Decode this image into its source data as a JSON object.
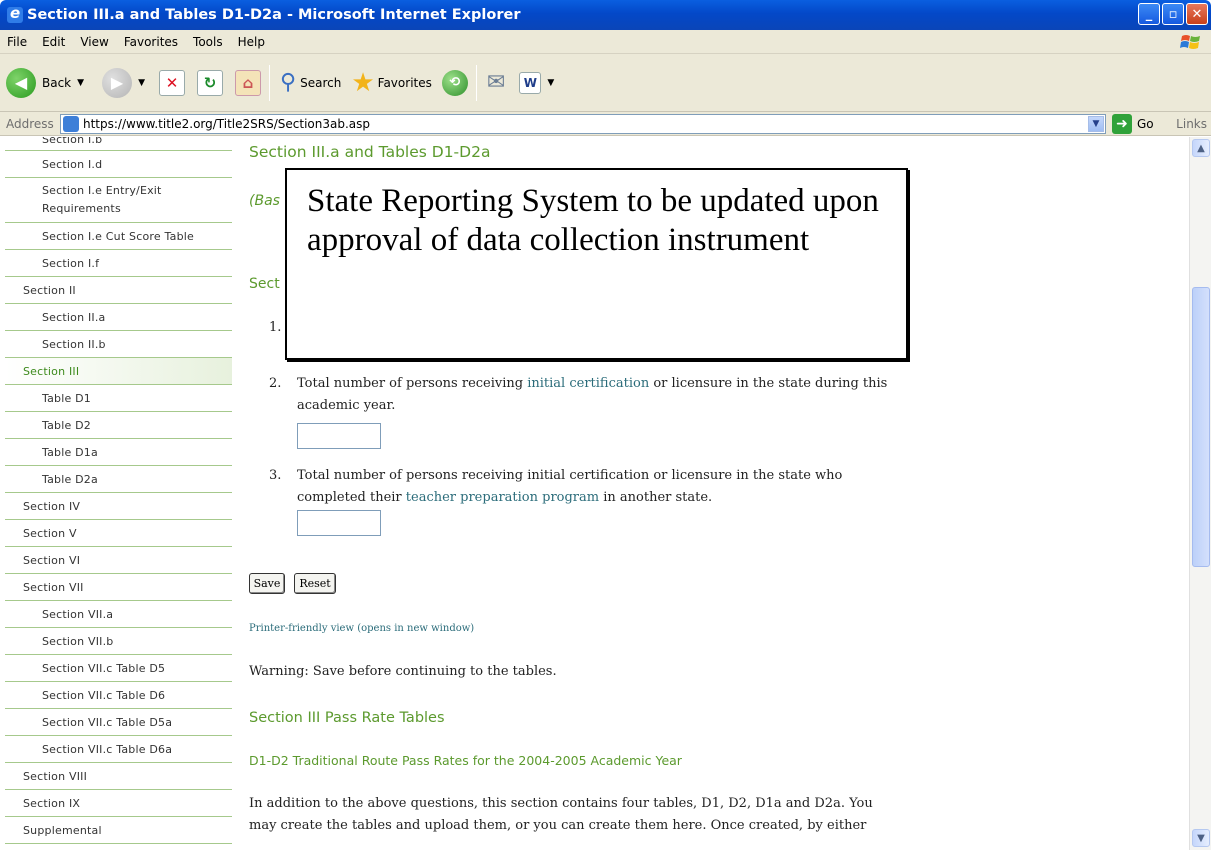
{
  "window": {
    "title": "Section III.a and Tables D1-D2a - Microsoft Internet Explorer",
    "buttons": [
      "_",
      "▫",
      "✕"
    ]
  },
  "menu": [
    "File",
    "Edit",
    "View",
    "Favorites",
    "Tools",
    "Help"
  ],
  "toolbar": {
    "back_label": "Back",
    "search_label": "Search",
    "favorites_label": "Favorites"
  },
  "address": {
    "label": "Address",
    "url": "https://www.title2.org/Title2SRS/Section3ab.asp",
    "go_label": "Go",
    "links_label": "Links"
  },
  "sidebar": {
    "items": [
      {
        "label": "Section I.b",
        "level": "sub"
      },
      {
        "label": "Section I.d",
        "level": "sub"
      },
      {
        "label": "Section I.e Entry/Exit Requirements",
        "level": "sub"
      },
      {
        "label": "Section I.e Cut Score Table",
        "level": "sub"
      },
      {
        "label": "Section I.f",
        "level": "sub"
      },
      {
        "label": "Section II",
        "level": "top"
      },
      {
        "label": "Section II.a",
        "level": "sub"
      },
      {
        "label": "Section II.b",
        "level": "sub"
      },
      {
        "label": "Section III",
        "level": "top",
        "active": true
      },
      {
        "label": "Table D1",
        "level": "sub"
      },
      {
        "label": "Table D2",
        "level": "sub"
      },
      {
        "label": "Table D1a",
        "level": "sub"
      },
      {
        "label": "Table D2a",
        "level": "sub"
      },
      {
        "label": "Section IV",
        "level": "top"
      },
      {
        "label": "Section V",
        "level": "top"
      },
      {
        "label": "Section VI",
        "level": "top"
      },
      {
        "label": "Section VII",
        "level": "top"
      },
      {
        "label": "Section VII.a",
        "level": "sub"
      },
      {
        "label": "Section VII.b",
        "level": "sub"
      },
      {
        "label": "Section VII.c Table D5",
        "level": "sub"
      },
      {
        "label": "Section VII.c Table D6",
        "level": "sub"
      },
      {
        "label": "Section VII.c Table D5a",
        "level": "sub"
      },
      {
        "label": "Section VII.c Table D6a",
        "level": "sub"
      },
      {
        "label": "Section VIII",
        "level": "top"
      },
      {
        "label": "Section IX",
        "level": "top"
      },
      {
        "label": "Supplemental",
        "level": "top"
      }
    ]
  },
  "main": {
    "heading": "Section III.a and Tables D1-D2a",
    "basis_fragment": "(Bas",
    "section_fragment": "Sect",
    "q1_number": "1.",
    "q2_number": "2.",
    "q2_pre": "Total number of persons receiving ",
    "q2_link": "initial certification",
    "q2_post": " or licensure in the state during this academic year.",
    "q3_number": "3.",
    "q3_pre": "Total number of persons receiving initial certification or licensure in the state who completed their ",
    "q3_link": "teacher preparation program",
    "q3_post": " in another state.",
    "save_label": "Save",
    "reset_label": "Reset",
    "printer_link": "Printer-friendly view (opens in new window)",
    "warning": "Warning: Save before continuing to the tables.",
    "pass_rate_heading": "Section III Pass Rate Tables",
    "d1d2_heading": "D1-D2 Traditional Route Pass Rates for the 2004-2005 Academic Year",
    "intro": "In addition to the above questions, this section contains four tables, D1, D2, D1a and D2a. You may create the tables and upload them, or you can create them here. Once created, by either"
  },
  "overlay": {
    "text": "State Reporting System to be updated upon approval of data collection instrument"
  }
}
